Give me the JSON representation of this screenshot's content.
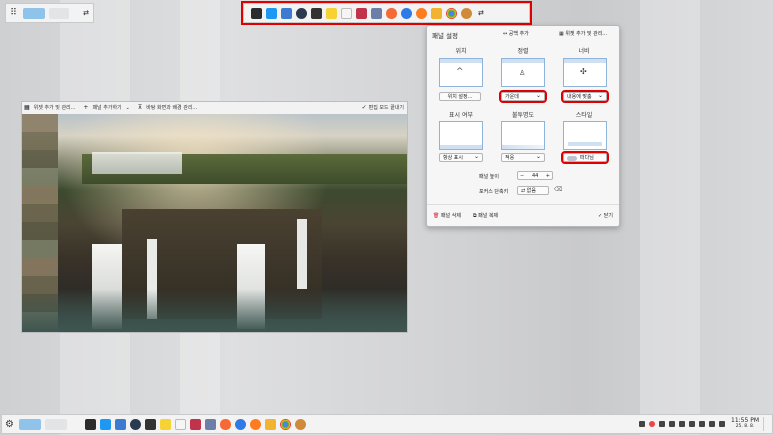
{
  "dialog": {
    "title": "패널 설정",
    "add_spacer": "공백 추가",
    "add_widget": "위젯 추가 및 관리...",
    "position_label": "위치",
    "position_button": "위치 설정...",
    "alignment_label": "정렬",
    "alignment_value": "가운데",
    "width_label": "너비",
    "width_value": "내용에 맞춤",
    "visibility_label": "표시 여부",
    "visibility_value": "항상 표시",
    "opacity_label": "불투명도",
    "opacity_value": "적응",
    "style_label": "스타일",
    "style_value": "떠다님",
    "height_label": "패널 높이",
    "height_value": "44",
    "minus": "−",
    "plus": "+",
    "shortcut_label": "포커스 단축키",
    "shortcut_value": "없음",
    "delete_panel": "패널 삭제",
    "copy_panel": "패널 복제",
    "close": "닫기"
  },
  "edit_toolbar": {
    "add_widget": "위젯 추가 및 관리...",
    "add_panel": "패널 추가하기",
    "configure": "바탕 화면과 배경 관리...",
    "exit": "편집 모드 끝내기"
  },
  "top_panel": {
    "launcher_icons": [
      "terminal",
      "dolphin",
      "files",
      "browser-dark",
      "konsole",
      "notes",
      "calendar",
      "screenshot",
      "office",
      "brave",
      "firefox-alt",
      "firefox",
      "pen",
      "chrome",
      "settings"
    ]
  },
  "clock": {
    "time": "11:55 PM",
    "date": "25. 8. 8."
  },
  "colors": {
    "highlight": "#e00000",
    "panel_bg": "#f3f3f4",
    "accent": "#3d8fe0"
  }
}
